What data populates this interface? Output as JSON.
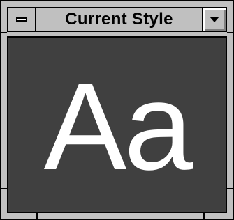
{
  "window": {
    "title": "Current Style",
    "system_menu_icon": "minus-bar-icon",
    "dropdown_icon": "triangle-down-icon"
  },
  "preview": {
    "sample_text": "Aa",
    "background_color": "#404040",
    "text_color": "#ffffff"
  }
}
